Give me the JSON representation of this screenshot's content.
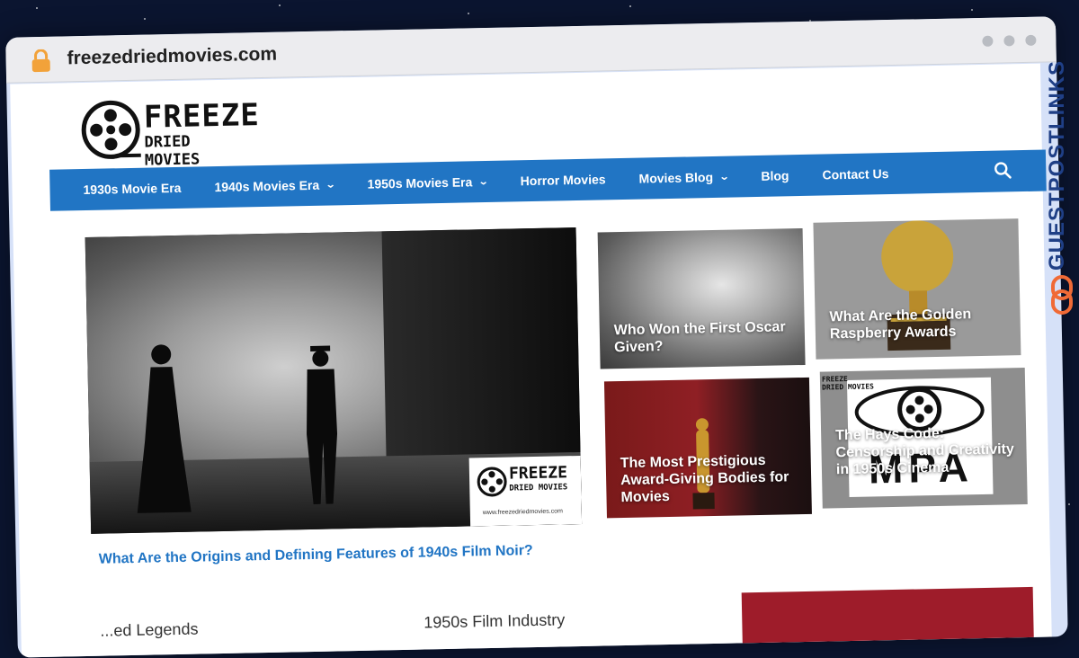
{
  "browser": {
    "url": "freezedriedmovies.com"
  },
  "site": {
    "logo": {
      "line1": "FREEZE",
      "line2": "DRIED MOVIES"
    }
  },
  "nav": {
    "items": [
      {
        "label": "1930s Movie Era",
        "has_dropdown": false
      },
      {
        "label": "1940s Movies Era",
        "has_dropdown": true
      },
      {
        "label": "1950s Movies Era",
        "has_dropdown": true
      },
      {
        "label": "Horror Movies",
        "has_dropdown": false
      },
      {
        "label": "Movies Blog",
        "has_dropdown": true
      },
      {
        "label": "Blog",
        "has_dropdown": false
      },
      {
        "label": "Contact Us",
        "has_dropdown": false
      }
    ],
    "search_icon": "search-icon"
  },
  "hero": {
    "title": "What Are the Origins and Defining Features of 1940s Film Noir?",
    "watermark": {
      "line1": "FREEZE",
      "line2": "DRIED MOVIES",
      "url": "www.freezedriedmovies.com"
    }
  },
  "cards": [
    {
      "title": "Who Won the First Oscar Given?"
    },
    {
      "title": "What Are the Golden Raspberry Awards"
    },
    {
      "title": "The Most Prestigious Award-Giving Bodies for Movies"
    },
    {
      "title": "The Hays Code: Censorship and Creativity in 1950s Cinema"
    }
  ],
  "card4_watermark": {
    "line1": "FREEZE",
    "line2": "DRIED MOVIES"
  },
  "card4_logo_text": "MPA",
  "below": {
    "left_partial": "...ed Legends",
    "mid_partial": "1950s Film Industry"
  },
  "side_banner": {
    "text_a": "GUESTPOST",
    "text_b": "LINKS"
  },
  "colors": {
    "nav_bg": "#2175c4",
    "link": "#2175c4",
    "side_brand": "#1f3f86",
    "side_accent": "#f06a36"
  }
}
